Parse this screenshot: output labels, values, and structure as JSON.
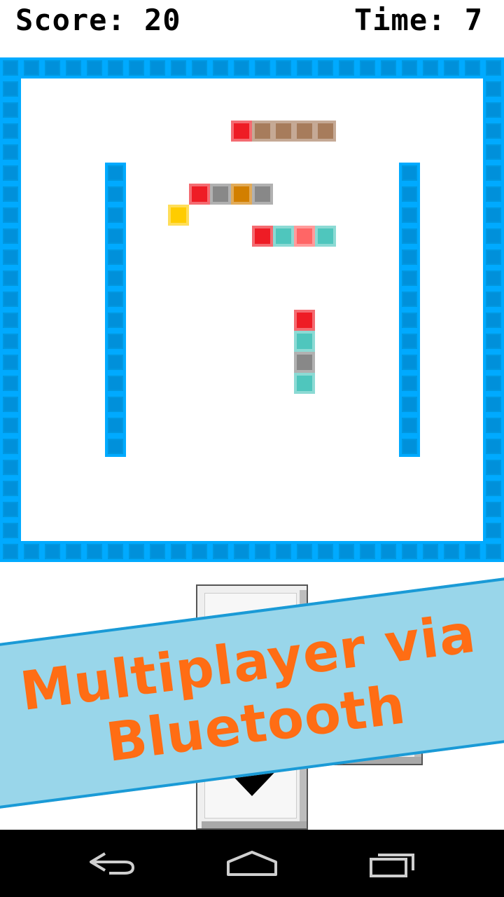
{
  "hud": {
    "score_text": "Score: 20",
    "time_text": "Time: 7"
  },
  "colors": {
    "wall": "#0097e0",
    "wall_light": "#00aaff",
    "snake_head": "#ee1c25",
    "brown": "#a77c5c",
    "gray": "#888888",
    "orange": "#d27f00",
    "teal": "#4fc6bd",
    "salmon": "#ff6666",
    "food": "#ffcc00",
    "banner_bg": "#99d6ea",
    "banner_text": "#ff6d14",
    "banner_border": "#1a9ad6"
  },
  "board": {
    "grid_size": 24,
    "snakes": [
      {
        "name": "snake-1",
        "segments": [
          {
            "col": 11,
            "row": 3,
            "color": "#ee1c25"
          },
          {
            "col": 12,
            "row": 3,
            "color": "#a77c5c"
          },
          {
            "col": 13,
            "row": 3,
            "color": "#a77c5c"
          },
          {
            "col": 14,
            "row": 3,
            "color": "#a77c5c"
          },
          {
            "col": 15,
            "row": 3,
            "color": "#a77c5c"
          }
        ]
      },
      {
        "name": "snake-2",
        "segments": [
          {
            "col": 9,
            "row": 6,
            "color": "#ee1c25"
          },
          {
            "col": 10,
            "row": 6,
            "color": "#888888"
          },
          {
            "col": 11,
            "row": 6,
            "color": "#d27f00"
          },
          {
            "col": 12,
            "row": 6,
            "color": "#888888"
          }
        ]
      },
      {
        "name": "snake-3",
        "segments": [
          {
            "col": 12,
            "row": 8,
            "color": "#ee1c25"
          },
          {
            "col": 13,
            "row": 8,
            "color": "#4fc6bd"
          },
          {
            "col": 14,
            "row": 8,
            "color": "#ff6666"
          },
          {
            "col": 15,
            "row": 8,
            "color": "#4fc6bd"
          }
        ]
      },
      {
        "name": "snake-4",
        "segments": [
          {
            "col": 14,
            "row": 12,
            "color": "#ee1c25"
          },
          {
            "col": 14,
            "row": 13,
            "color": "#4fc6bd"
          },
          {
            "col": 14,
            "row": 14,
            "color": "#888888"
          },
          {
            "col": 14,
            "row": 15,
            "color": "#4fc6bd"
          }
        ]
      }
    ],
    "food": {
      "col": 8,
      "row": 7,
      "color": "#ffcc00"
    },
    "inner_walls": [
      {
        "col": 5,
        "row_start": 5,
        "row_end": 18
      },
      {
        "col": 19,
        "row_start": 5,
        "row_end": 18
      }
    ]
  },
  "controls": {
    "down_button": "down-arrow",
    "right_button": "right-button"
  },
  "banner": {
    "line1": "Multiplayer via",
    "line2": "Bluetooth"
  },
  "navbar": {
    "back": "back-icon",
    "home": "home-icon",
    "recents": "recents-icon"
  }
}
